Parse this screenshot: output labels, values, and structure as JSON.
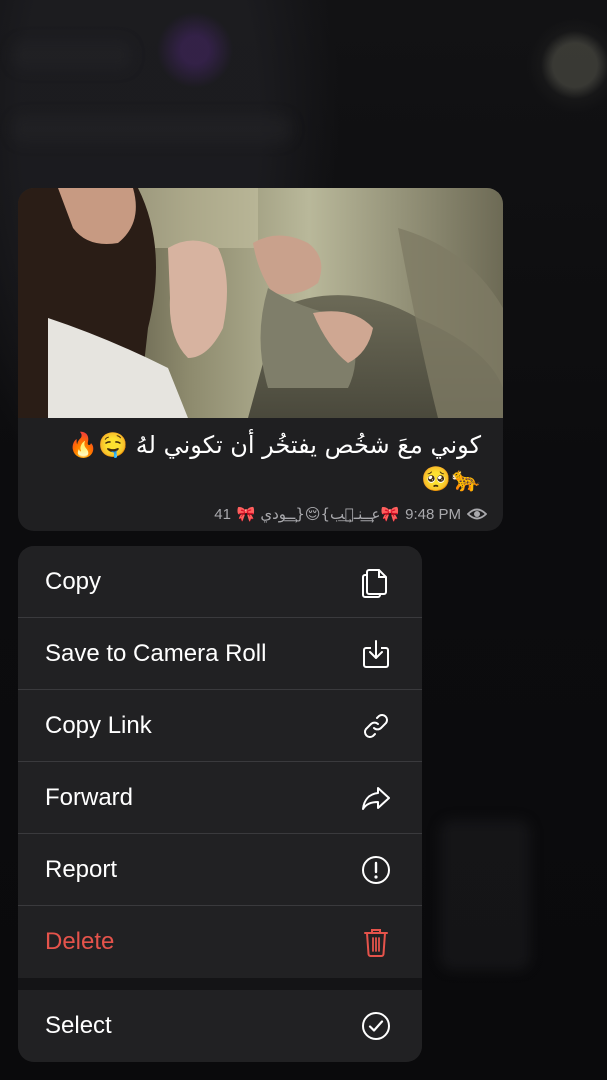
{
  "message": {
    "caption_line1": "كوني معَ شخُص يفتخُر أن تكوني لهُ 🤤🔥",
    "caption_line2": "🐆🥺",
    "views": "41",
    "signature": "🎀عـ͢͢ـنـ٘͢ب}😌{ـ͢͢ـودي 🎀",
    "time": "9:48 PM",
    "eye_icon": "eye-icon"
  },
  "menu": {
    "items": [
      {
        "label": "Copy",
        "icon": "copy-icon"
      },
      {
        "label": "Save to Camera Roll",
        "icon": "download-icon"
      },
      {
        "label": "Copy Link",
        "icon": "link-icon"
      },
      {
        "label": "Forward",
        "icon": "forward-arrow-icon"
      },
      {
        "label": "Report",
        "icon": "exclamation-circle-icon"
      },
      {
        "label": "Delete",
        "icon": "trash-icon"
      },
      {
        "label": "Select",
        "icon": "checkmark-circle-icon"
      }
    ]
  },
  "colors": {
    "destructive": "#e5534b",
    "menu_background": "#212123",
    "bubble_background": "#1f1f21"
  }
}
